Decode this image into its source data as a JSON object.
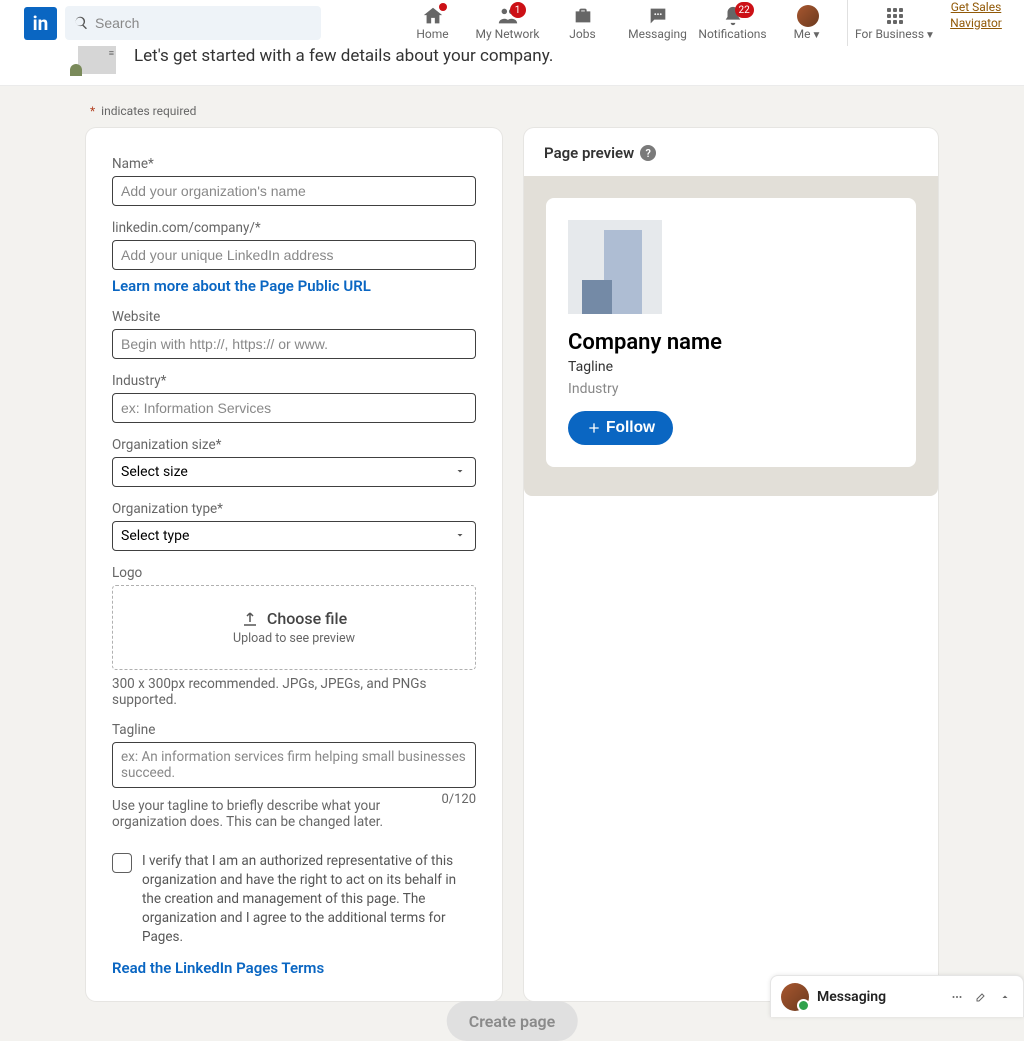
{
  "nav": {
    "search_placeholder": "Search",
    "home": "Home",
    "network": "My Network",
    "jobs": "Jobs",
    "messaging": "Messaging",
    "notifications": "Notifications",
    "me": "Me",
    "business": "For Business",
    "sales_nav": "Get Sales Navigator",
    "badges": {
      "network": "1",
      "notifications": "22"
    }
  },
  "subheader": "Let's get started with a few details about your company.",
  "required_note": "indicates required",
  "form": {
    "name_label": "Name*",
    "name_placeholder": "Add your organization's name",
    "url_label": "linkedin.com/company/*",
    "url_placeholder": "Add your unique LinkedIn address",
    "url_learn_more": "Learn more about the Page Public URL",
    "website_label": "Website",
    "website_placeholder": "Begin with http://, https:// or www.",
    "industry_label": "Industry*",
    "industry_placeholder": "ex: Information Services",
    "size_label": "Organization size*",
    "size_placeholder": "Select size",
    "type_label": "Organization type*",
    "type_placeholder": "Select type",
    "logo_label": "Logo",
    "logo_choose": "Choose file",
    "logo_sub": "Upload to see preview",
    "logo_helper": "300 x 300px recommended. JPGs, JPEGs, and PNGs supported.",
    "tagline_label": "Tagline",
    "tagline_placeholder": "ex: An information services firm helping small businesses succeed.",
    "tagline_helper": "Use your tagline to briefly describe what your organization does. This can be changed later.",
    "tagline_counter": "0/120",
    "verify_text": "I verify that I am an authorized representative of this organization and have the right to act on its behalf in the creation and management of this page. The organization and I agree to the additional terms for Pages.",
    "terms_link": "Read the LinkedIn Pages Terms"
  },
  "preview": {
    "title": "Page preview",
    "company_name": "Company name",
    "tagline": "Tagline",
    "industry": "Industry",
    "follow": "Follow"
  },
  "messaging_bar": "Messaging",
  "create_button": "Create page"
}
